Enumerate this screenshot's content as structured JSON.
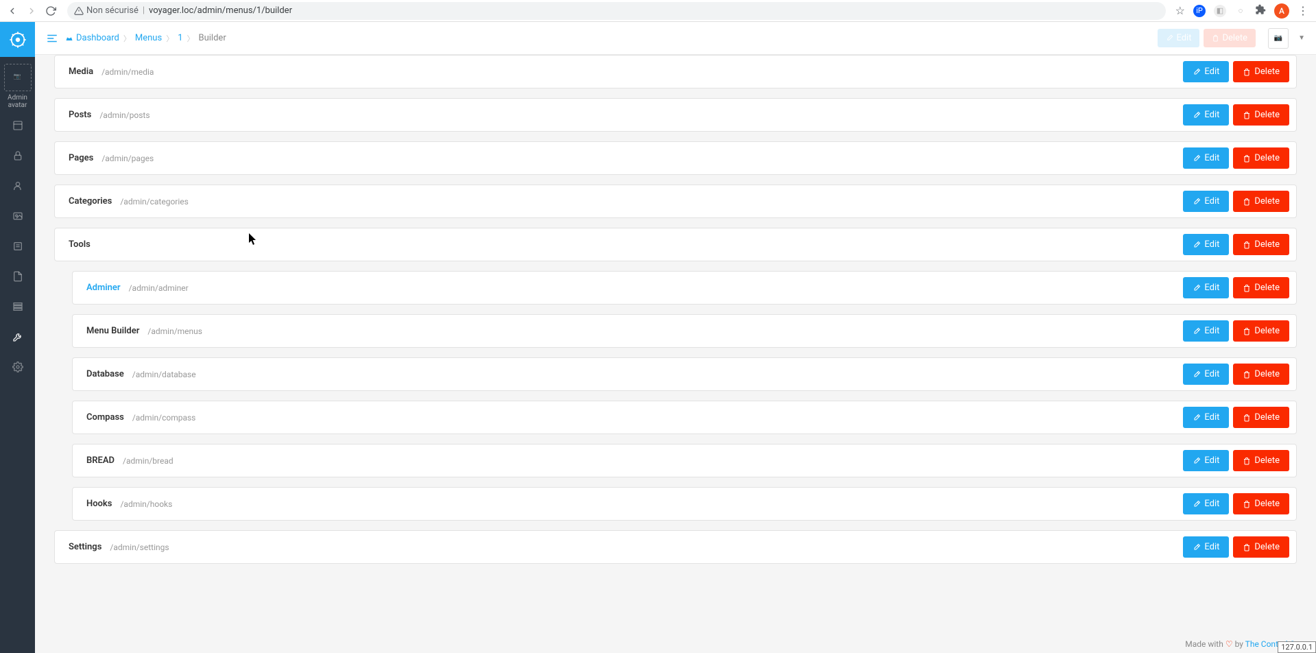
{
  "browser": {
    "not_secure": "Non sécurisé",
    "url": "voyager.loc/admin/menus/1/builder",
    "avatar_letter": "A"
  },
  "sidebar": {
    "avatar_alt": "Admin avatar"
  },
  "header": {
    "dashboard": "Dashboard",
    "menus": "Menus",
    "one": "1",
    "builder": "Builder",
    "edit": "Edit",
    "delete": "Delete"
  },
  "buttons": {
    "edit": "Edit",
    "delete": "Delete"
  },
  "items": [
    {
      "label": "Media",
      "url": "/admin/media",
      "nested": false,
      "link": false
    },
    {
      "label": "Posts",
      "url": "/admin/posts",
      "nested": false,
      "link": false
    },
    {
      "label": "Pages",
      "url": "/admin/pages",
      "nested": false,
      "link": false
    },
    {
      "label": "Categories",
      "url": "/admin/categories",
      "nested": false,
      "link": false
    },
    {
      "label": "Tools",
      "url": "",
      "nested": false,
      "link": false
    },
    {
      "label": "Adminer",
      "url": "/admin/adminer",
      "nested": true,
      "link": true
    },
    {
      "label": "Menu Builder",
      "url": "/admin/menus",
      "nested": true,
      "link": false
    },
    {
      "label": "Database",
      "url": "/admin/database",
      "nested": true,
      "link": false
    },
    {
      "label": "Compass",
      "url": "/admin/compass",
      "nested": true,
      "link": false
    },
    {
      "label": "BREAD",
      "url": "/admin/bread",
      "nested": true,
      "link": false
    },
    {
      "label": "Hooks",
      "url": "/admin/hooks",
      "nested": true,
      "link": false
    },
    {
      "label": "Settings",
      "url": "/admin/settings",
      "nested": false,
      "link": false
    }
  ],
  "footer": {
    "made": "Made with",
    "by": "by",
    "company": "The Control Group",
    "ip": "127.0.0.1"
  }
}
